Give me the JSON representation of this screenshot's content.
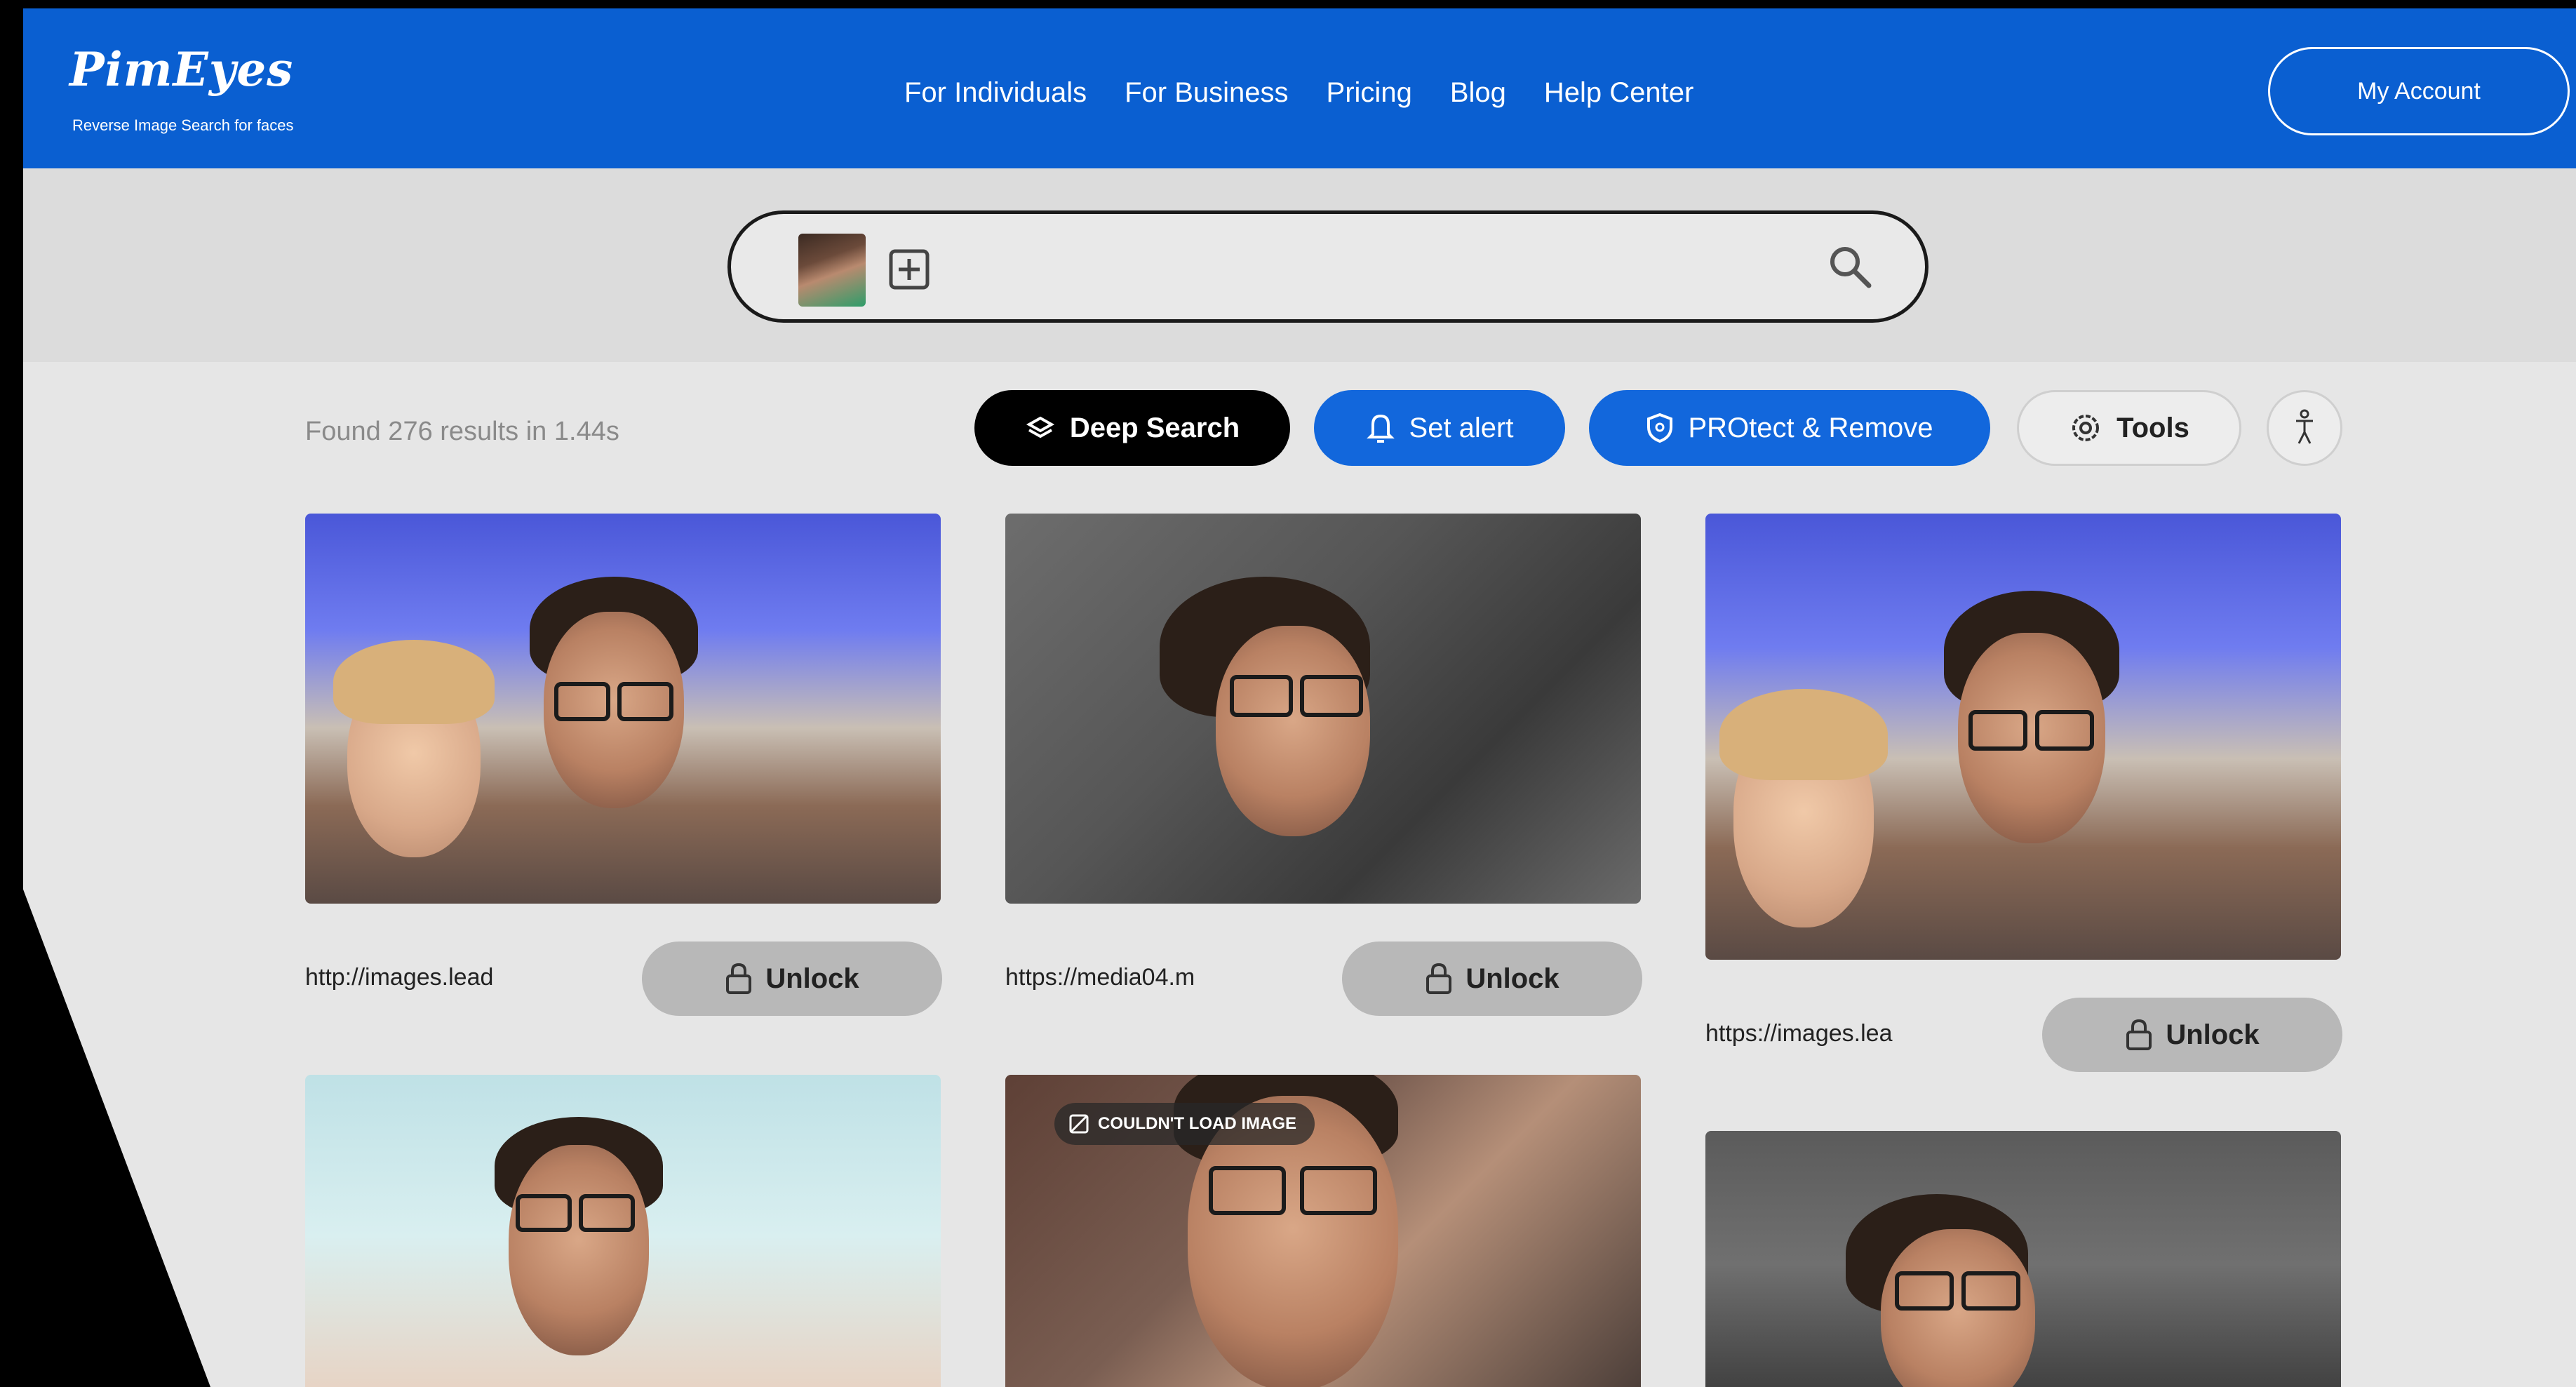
{
  "header": {
    "logo": "PimEyes",
    "tagline": "Reverse Image Search for faces",
    "nav": [
      "For Individuals",
      "For Business",
      "Pricing",
      "Blog",
      "Help Center"
    ],
    "account_label": "My Account"
  },
  "search": {
    "thumbnail": "uploaded-face",
    "add_icon": "plus-square-icon",
    "search_icon": "magnifier-icon"
  },
  "results": {
    "count_text": "Found 276 results in 1.44s"
  },
  "toolbar": {
    "deep_search": "Deep Search",
    "set_alert": "Set alert",
    "protect_remove": "PROtect & Remove",
    "tools": "Tools",
    "accessibility_icon": "accessibility-icon"
  },
  "cards": [
    {
      "url": "http://images.lead",
      "unlock": "Unlock"
    },
    {
      "url": "https://media04.m",
      "unlock": "Unlock"
    },
    {
      "url": "https://images.lea",
      "unlock": "Unlock"
    }
  ],
  "badge": {
    "text": "COULDN'T LOAD IMAGE"
  },
  "colors": {
    "header_blue": "#0a5fd1",
    "button_blue": "#1267dc",
    "background": "#e6e6e6",
    "deep_black": "#000000",
    "unlock_gray": "#b8b8b8"
  }
}
